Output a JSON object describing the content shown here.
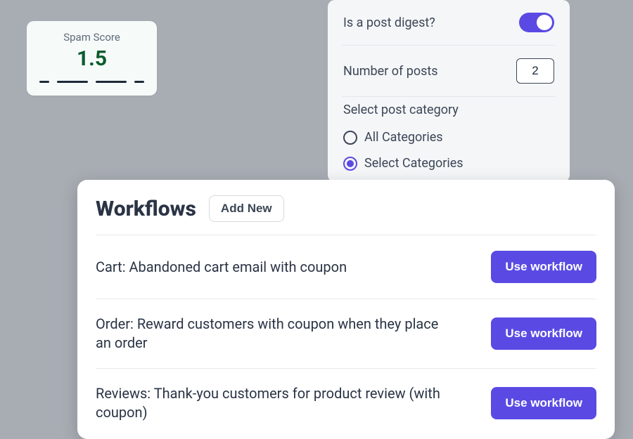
{
  "spam": {
    "label": "Spam Score",
    "value": "1.5"
  },
  "settings": {
    "digest_label": "Is a post digest?",
    "digest_on": true,
    "num_posts_label": "Number of posts",
    "num_posts_value": "2",
    "category_label": "Select post category",
    "radio_all": "All Categories",
    "radio_select": "Select Categories",
    "radio_selected": "select"
  },
  "workflows": {
    "title": "Workflows",
    "add_label": "Add New",
    "use_label": "Use workflow",
    "items": [
      {
        "name": "Cart: Abandoned cart email with coupon"
      },
      {
        "name": "Order: Reward customers with coupon when they place an order"
      },
      {
        "name": "Reviews: Thank-you customers for product review (with coupon)"
      }
    ]
  }
}
